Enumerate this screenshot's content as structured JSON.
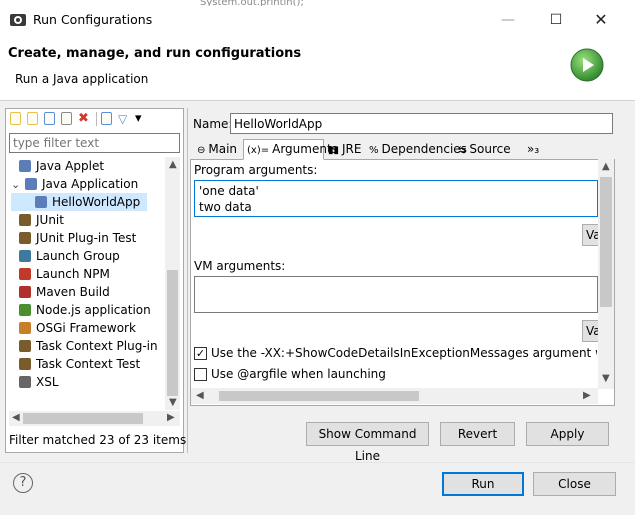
{
  "window": {
    "title": "Run Configurations",
    "minimize": "—",
    "maximize": "☐",
    "close": "✕",
    "background_code": "System.out.println();"
  },
  "header": {
    "title": "Create, manage, and run configurations",
    "subtitle": "Run a Java application",
    "badge_icon": "run-play-icon",
    "badge_color": "#3c9b3c"
  },
  "left": {
    "toolbar_icons": [
      "new-config-icon",
      "new-prototype-icon",
      "export-icon",
      "duplicate-icon",
      "delete-icon",
      "collapse-all-icon",
      "filter-icon",
      "view-menu-icon"
    ],
    "filter_placeholder": "type filter text",
    "tree": [
      {
        "label": "Java Applet",
        "icon": "java-applet-icon",
        "color": "#5b7db8",
        "indent": 1
      },
      {
        "label": "Java Application",
        "icon": "java-app-icon",
        "color": "#5b7db8",
        "indent": 0,
        "expanded": true
      },
      {
        "label": "HelloWorldApp",
        "icon": "java-app-icon",
        "color": "#5b7db8",
        "indent": 2,
        "selected": true
      },
      {
        "label": "JUnit",
        "icon": "junit-icon",
        "color": "#7a5b2c",
        "indent": 1
      },
      {
        "label": "JUnit Plug-in Test",
        "icon": "junit-plugin-icon",
        "color": "#7a5b2c",
        "indent": 1
      },
      {
        "label": "Launch Group",
        "icon": "launch-group-icon",
        "color": "#3f7a9c",
        "indent": 1
      },
      {
        "label": "Launch NPM",
        "icon": "npm-icon",
        "color": "#c0392b",
        "indent": 1
      },
      {
        "label": "Maven Build",
        "icon": "maven-icon",
        "color": "#b0302b",
        "indent": 1
      },
      {
        "label": "Node.js application",
        "icon": "nodejs-icon",
        "color": "#4a8f2e",
        "indent": 1
      },
      {
        "label": "OSGi Framework",
        "icon": "osgi-icon",
        "color": "#c87f2a",
        "indent": 1
      },
      {
        "label": "Task Context Plug-in",
        "icon": "task-context-plugin-icon",
        "color": "#7a5b2c",
        "indent": 1
      },
      {
        "label": "Task Context Test",
        "icon": "task-context-test-icon",
        "color": "#7a5b2c",
        "indent": 1
      },
      {
        "label": "XSL",
        "icon": "xsl-icon",
        "color": "#666666",
        "indent": 1
      }
    ],
    "status": "Filter matched 23 of 23 items"
  },
  "right": {
    "name_label": "Name:",
    "name_value": "HelloWorldApp",
    "tabs": [
      {
        "label": "Main",
        "icon": "main-tab-icon",
        "icon_glyph": "⊖"
      },
      {
        "label": "Arguments",
        "icon": "arguments-tab-icon",
        "icon_glyph": "(x)=",
        "active": true
      },
      {
        "label": "JRE",
        "icon": "jre-tab-icon",
        "icon_glyph": "▮▮"
      },
      {
        "label": "Dependencies",
        "icon": "dependencies-tab-icon",
        "icon_glyph": "%"
      },
      {
        "label": "Source",
        "icon": "source-tab-icon",
        "icon_glyph": "⇆"
      }
    ],
    "tabs_overflow": "»₃",
    "program_args_label": "Program arguments:",
    "program_args_value": "'one data'\ntwo data",
    "variables_label": "Variables...",
    "vm_args_label": "VM arguments:",
    "vm_args_value": "",
    "checkbox1_label": "Use the -XX:+ShowCodeDetailsInExceptionMessages argument when launching",
    "checkbox1_checked": "✓",
    "checkbox2_label": "Use @argfile when launching",
    "show_command_line": "Show Command Line",
    "revert": "Revert",
    "apply": "Apply"
  },
  "footer": {
    "help": "?",
    "run": "Run",
    "close": "Close"
  },
  "colors": {
    "selection": "#cde8ff",
    "focus_border": "#0078d7",
    "button_face": "#e1e1e1"
  }
}
